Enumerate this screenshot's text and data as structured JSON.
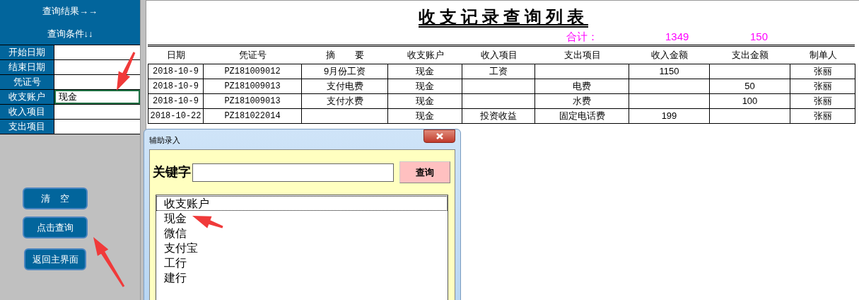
{
  "sidebar": {
    "headers": [
      "查询结果→→",
      "查询条件↓↓"
    ],
    "fields": [
      {
        "label": "开始日期",
        "selected": false
      },
      {
        "label": "结束日期",
        "selected": false
      },
      {
        "label": "凭证号",
        "selected": false
      },
      {
        "label": "收支账户",
        "value": "现金",
        "selected": true
      },
      {
        "label": "收入项目",
        "selected": false
      },
      {
        "label": "支出项目",
        "selected": false
      }
    ],
    "buttons": [
      "清    空",
      "点击查询",
      "返回主界面"
    ]
  },
  "sheet": {
    "title": "收支记录查询列表",
    "total_label": "合计：",
    "total_income": "1349",
    "total_expense": "150",
    "columns": [
      "日期",
      "凭证号",
      "摘        要",
      "收支账户",
      "收入项目",
      "支出项目",
      "收入金额",
      "支出金额",
      "制单人"
    ],
    "rows": [
      [
        "2018-10-9",
        "PZ181009012",
        "9月份工资",
        "现金",
        "工资",
        "",
        "1150",
        "",
        "张丽"
      ],
      [
        "2018-10-9",
        "PZ181009013",
        "支付电费",
        "现金",
        "",
        "电费",
        "",
        "50",
        "张丽"
      ],
      [
        "2018-10-9",
        "PZ181009013",
        "支付水费",
        "现金",
        "",
        "水费",
        "",
        "100",
        "张丽"
      ],
      [
        "2018-10-22",
        "PZ181022014",
        "",
        "现金",
        "投资收益",
        "固定电话费",
        "199",
        "",
        "张丽"
      ]
    ]
  },
  "dialog": {
    "title": "辅助录入",
    "keyword_label": "关键字",
    "search_button": "查询",
    "items": [
      {
        "label": "收支账户",
        "selected": true
      },
      {
        "label": "现金",
        "selected": false
      },
      {
        "label": "微信",
        "selected": false
      },
      {
        "label": "支付宝",
        "selected": false
      },
      {
        "label": "工行",
        "selected": false
      },
      {
        "label": "建行",
        "selected": false
      }
    ]
  }
}
